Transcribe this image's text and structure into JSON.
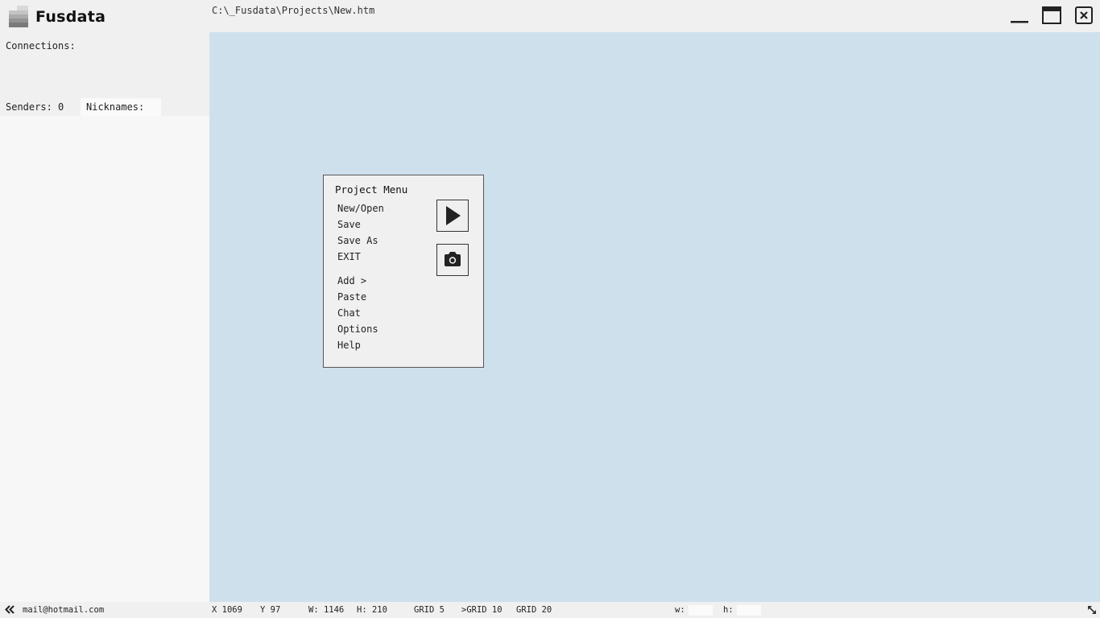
{
  "app": {
    "name": "Fusdata",
    "file_path": "C:\\_Fusdata\\Projects\\New.htm"
  },
  "window_controls": {
    "minimize": "minimize-icon",
    "maximize": "maximize-icon",
    "close": "close-icon"
  },
  "sidebar": {
    "connections_label": "Connections:",
    "senders_label": "Senders: 0",
    "nicknames_label": "Nicknames:"
  },
  "project_menu": {
    "title": "Project Menu",
    "items": [
      "New/Open",
      "Save",
      "Save As",
      "EXIT",
      "Add >",
      "Paste",
      "Chat",
      "Options",
      "Help"
    ],
    "buttons": {
      "run": "play-icon",
      "snapshot": "camera-icon"
    }
  },
  "statusbar": {
    "collapse_icon": "double-chevron-left-icon",
    "email": "mail@hotmail.com",
    "x": "X 1069",
    "y": "Y 97",
    "w": "W: 1146",
    "h": "H: 210",
    "grid5": "GRID 5",
    "grid10": ">GRID 10",
    "grid20": "GRID 20",
    "w_input_label": "w:",
    "h_input_label": "h:",
    "resize_icon": "resize-diagonal-icon"
  },
  "colors": {
    "canvas": "#cfe0ed",
    "panel": "#f0f0f0",
    "sidebar": "#f7f7f7"
  }
}
